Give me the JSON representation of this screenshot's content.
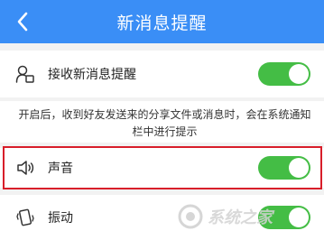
{
  "header": {
    "title": "新消息提醒",
    "background": "#3a8ef6"
  },
  "icons": {
    "back": "chevron-left-icon",
    "receive": "person-notification-icon",
    "sound": "speaker-icon",
    "vibrate": "phone-vibrate-icon"
  },
  "settings": {
    "receive_label": "接收新消息提醒",
    "receive_on": true,
    "description": "开启后，收到好友发送来的分享文件或消息时，会在系统通知栏中进行提示",
    "sound_label": "声音",
    "sound_on": true,
    "vibrate_label": "振动",
    "vibrate_on": true
  },
  "watermark": {
    "text": "系统之家"
  },
  "colors": {
    "toggle_on": "#44bd45",
    "highlight": "#d81e2a"
  }
}
